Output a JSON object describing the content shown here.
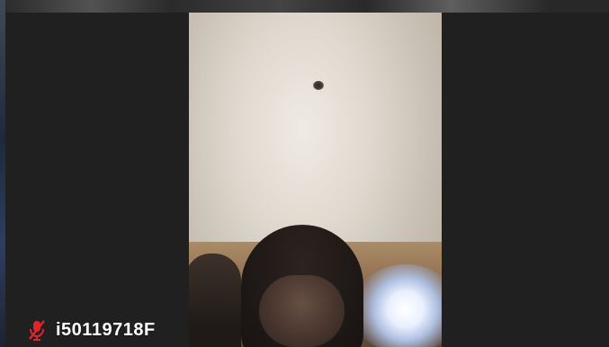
{
  "participant": {
    "display_name": "i50119718F",
    "audio_status": "muted"
  },
  "icons": {
    "mic_status": "muted-microphone-icon"
  },
  "colors": {
    "background": "#202020",
    "muted_mic": "#e0242a",
    "label_text": "#ffffff"
  }
}
